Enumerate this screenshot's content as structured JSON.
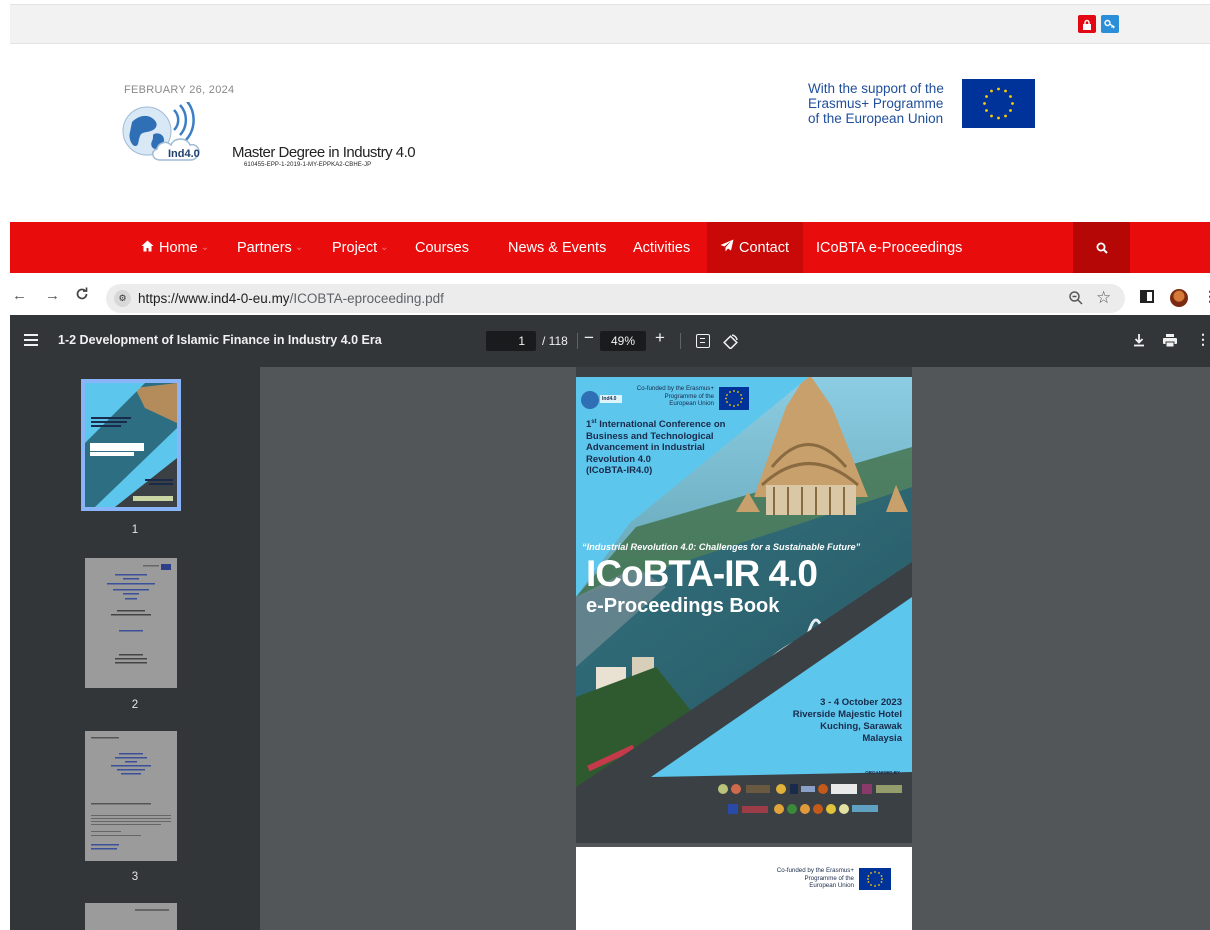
{
  "site": {
    "date": "FEBRUARY 26, 2024",
    "logo_text": "Ind4.0",
    "logo_title": "Master Degree in Industry 4.0",
    "logo_code": "610455-EPP-1-2019-1-MY-EPPKA2-CBHE-JP",
    "eu_support_text": "With the support of the Erasmus+ Programme of the European Union"
  },
  "nav": {
    "items": [
      {
        "label": "Home",
        "caret": "⌄"
      },
      {
        "label": "Partners",
        "caret": "⌄"
      },
      {
        "label": "Project",
        "caret": "⌄"
      },
      {
        "label": "Courses"
      },
      {
        "label": "News & Events"
      },
      {
        "label": "Activities"
      },
      {
        "label": "Contact"
      },
      {
        "label": "ICoBTA e-Proceedings"
      }
    ],
    "search_icon": "search-icon"
  },
  "browser": {
    "url_host": "https://www.ind4-0-eu.my",
    "url_path": "/ICOBTA-eproceeding.pdf"
  },
  "pdf": {
    "title": "1-2 Development of Islamic Finance in Industry 4.0 Era",
    "page_current": "1",
    "page_total": "/ 118",
    "zoom": "49%",
    "thumbnails": [
      "1",
      "2",
      "3"
    ]
  },
  "cover": {
    "cofunded": "Co-funded by the Erasmus+ Programme of the European Union",
    "conf_line1": "1st International Conference on",
    "conf_sup": "st",
    "conf_lines": [
      "Business and Technological",
      "Advancement in Industrial",
      "Revolution 4.0",
      "(ICoBTA-IR4.0)"
    ],
    "theme": "“Industrial Revolution 4.0: Challenges for a Sustainable Future”",
    "big_title": "ICoBTA-IR 4.0",
    "subtitle": "e-Proceedings Book",
    "date": "3 - 4 October 2023",
    "venue_lines": [
      "Riverside Majestic Hotel",
      "Kuching, Sarawak",
      "Malaysia"
    ],
    "organised": "ORGANISED BY"
  },
  "page2": {
    "cofunded": "Co-funded by the Erasmus+ Programme of the European Union"
  },
  "colors": {
    "nav_red": "#e80c0c",
    "eu_blue": "#003399",
    "pdf_toolbar": "#323639",
    "cover_cyan": "#5cc6ed",
    "cover_dark": "#3b4045"
  }
}
